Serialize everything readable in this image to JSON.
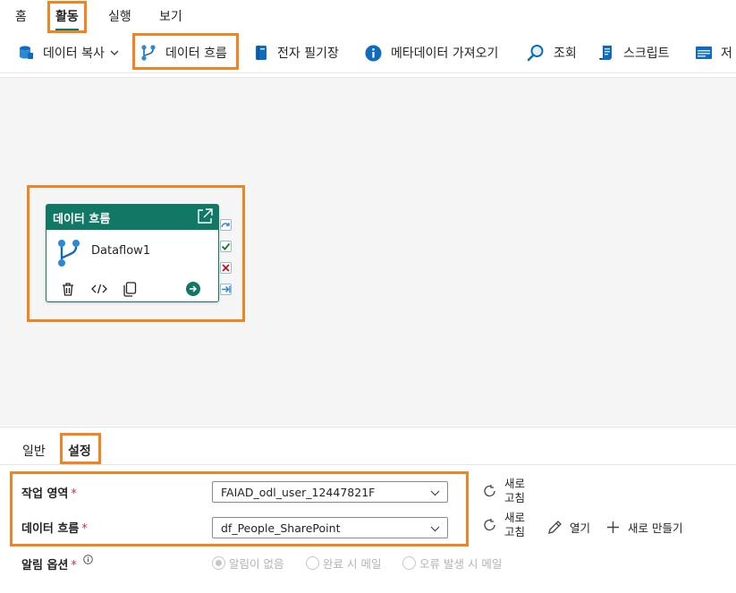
{
  "menu": {
    "tabs": [
      {
        "label": "홈"
      },
      {
        "label": "활동"
      },
      {
        "label": "실행"
      },
      {
        "label": "보기"
      }
    ]
  },
  "toolbar": {
    "items": [
      {
        "label": "데이터 복사",
        "icon": "database-copy-icon"
      },
      {
        "label": "데이터 흐름",
        "icon": "dataflow-icon"
      },
      {
        "label": "전자 필기장",
        "icon": "notebook-icon"
      },
      {
        "label": "메타데이터 가져오기",
        "icon": "info-icon"
      },
      {
        "label": "조회",
        "icon": "lookup-icon"
      },
      {
        "label": "스크립트",
        "icon": "script-icon"
      },
      {
        "label": "저",
        "icon": "stored-procedure-icon"
      }
    ]
  },
  "activity": {
    "header": "데이터 흐름",
    "name": "Dataflow1"
  },
  "panel": {
    "tabs": [
      {
        "label": "일반"
      },
      {
        "label": "설정"
      }
    ],
    "workspace_label": "작업 영역",
    "workspace_value": "FAIAD_odl_user_12447821F",
    "dataflow_label": "데이터 흐름",
    "dataflow_value": "df_People_SharePoint",
    "required_mark": "*",
    "refresh_label": "새로\n고침",
    "refresh_label_line1": "새로",
    "refresh_label_line2": "고침",
    "open_label": "열기",
    "new_label": "새로 만들기",
    "notify_label": "알림 옵션",
    "notify_options": [
      "알림이 없음",
      "완료 시 메일",
      "오류 발생 시 메일"
    ],
    "notify_selected": 0
  },
  "colors": {
    "accent": "#117865",
    "highlight": "#f58220",
    "required": "#c4314b",
    "icon_blue": "#0f6cbd"
  }
}
